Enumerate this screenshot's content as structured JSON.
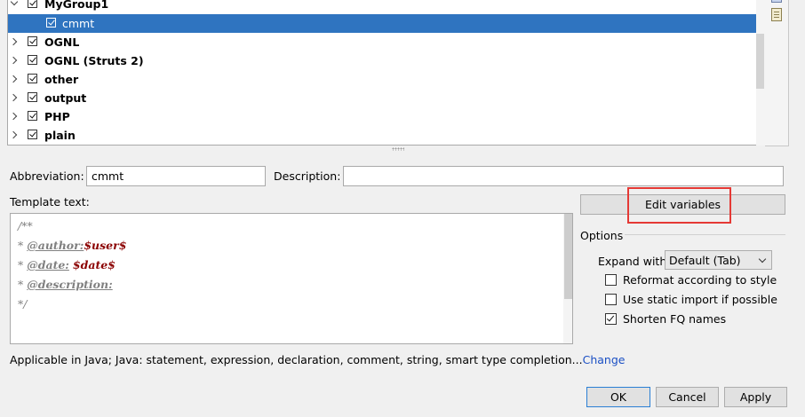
{
  "tree": {
    "items": [
      {
        "label": "MyGroup1",
        "expanded": true,
        "checked": true,
        "bold": true
      },
      {
        "label": "cmmt",
        "checked": true,
        "selected": true,
        "child": true
      },
      {
        "label": "OGNL",
        "checked": true,
        "bold": true
      },
      {
        "label": "OGNL (Struts 2)",
        "checked": true,
        "bold": true
      },
      {
        "label": "other",
        "checked": true,
        "bold": true
      },
      {
        "label": "output",
        "checked": true,
        "bold": true
      },
      {
        "label": "PHP",
        "checked": true,
        "bold": true
      },
      {
        "label": "plain",
        "checked": true,
        "bold": true
      }
    ]
  },
  "form": {
    "abbreviation_label": "Abbreviation:",
    "abbreviation_value": "cmmt",
    "description_label": "Description:",
    "description_value": "",
    "template_label": "Template text:"
  },
  "template": {
    "line1": "/**",
    "line2_prefix": "* ",
    "line2_tag": "@author:",
    "line2_var": "$user$",
    "line3_prefix": "* ",
    "line3_tag": "@date:",
    "line3_var": "$date$",
    "line4_prefix": "* ",
    "line4_tag": "@description:",
    "line5": "*/"
  },
  "buttons": {
    "edit_variables": "Edit variables",
    "ok": "OK",
    "cancel": "Cancel",
    "apply": "Apply"
  },
  "options": {
    "title": "Options",
    "expand_label": "Expand with",
    "expand_value": "Default (Tab)",
    "reformat_label": "Reformat according to style",
    "reformat_checked": false,
    "static_import_label": "Use static import if possible",
    "static_import_checked": false,
    "shorten_label": "Shorten FQ names",
    "shorten_checked": true
  },
  "context": {
    "text": "Applicable in Java; Java: statement, expression, declaration, comment, string, smart type completion...",
    "change_link": "Change"
  },
  "colors": {
    "selection": "#2f74c0",
    "highlight": "#e53935",
    "link": "#1a4fc4",
    "template_var": "#8b0000"
  }
}
